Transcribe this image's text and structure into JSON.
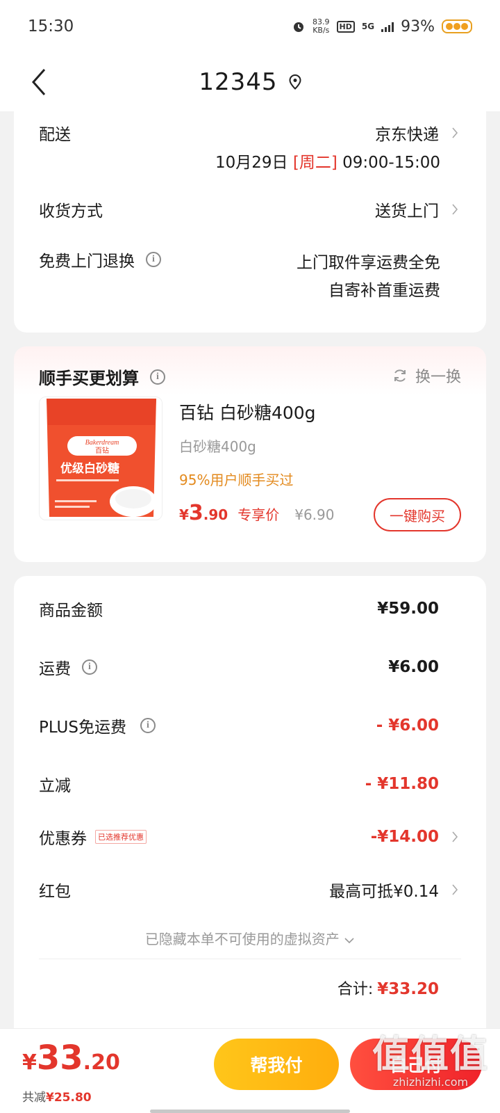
{
  "status_bar": {
    "time": "15:30",
    "net_speed_value": "83.9",
    "net_speed_unit": "KB/s",
    "hd": "HD",
    "network": "5G",
    "battery": "93%"
  },
  "nav": {
    "title": "12345"
  },
  "delivery": {
    "shipping_label": "配送",
    "shipping_value": "京东快递",
    "date": "10月29日",
    "weekday": "[周二]",
    "time_window": "09:00-15:00",
    "receive_label": "收货方式",
    "receive_value": "送货上门",
    "return_label": "免费上门退换",
    "return_line1": "上门取件享运费全免",
    "return_line2": "自寄补首重运费"
  },
  "addon": {
    "title": "顺手买更划算",
    "swap_label": "换一换",
    "product_name": "百钻 白砂糖400g",
    "spec": "白砂糖400g",
    "social_proof": "95%用户顺手买过",
    "price_symbol": "¥",
    "price_int": "3",
    "price_dec": ".90",
    "price_tag": "专享价",
    "original_price": "¥6.90",
    "buy_label": "一键购买",
    "package_brand_en": "Bakerdream",
    "package_brand_cn": "百钻",
    "package_product": "优级白砂糖"
  },
  "pricing": {
    "rows": [
      {
        "label": "商品金额",
        "value": "¥59.00"
      },
      {
        "label": "运费",
        "value": "¥6.00"
      },
      {
        "label": "PLUS免运费",
        "value": "- ¥6.00"
      },
      {
        "label": "立减",
        "value": "- ¥11.80"
      },
      {
        "label": "优惠券",
        "tag": "已选推荐优惠",
        "value": "-¥14.00"
      },
      {
        "label": "红包",
        "value": "最高可抵¥0.14"
      }
    ],
    "hidden_assets": "已隐藏本单不可使用的虚拟资产",
    "total_label": "合计:",
    "total_value": "¥33.20"
  },
  "bottom": {
    "symbol": "¥",
    "int": "33",
    "dec": ".20",
    "saved_label": "共减",
    "saved_value": "¥25.80",
    "help_pay": "帮我付",
    "self_pay": "自己付"
  },
  "watermark": {
    "big": "值值值",
    "small": "zhizhizhi.com"
  },
  "colors": {
    "accent_red": "#e3362c",
    "orange": "#e38a1e",
    "yellow_btn": "#ffc61a"
  }
}
